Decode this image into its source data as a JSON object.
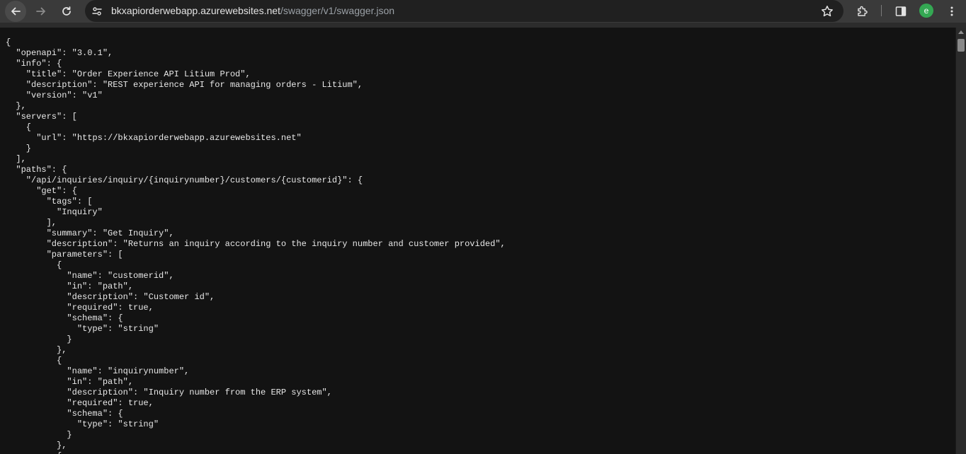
{
  "browser": {
    "url_host": "bkxapiorderwebapp.azurewebsites.net",
    "url_path": "/swagger/v1/swagger.json",
    "profile_initial": "e",
    "icons": {
      "back": "arrow-left-icon",
      "forward": "arrow-right-icon",
      "reload": "reload-icon",
      "site_info": "tune-icon",
      "bookmark": "star-icon",
      "extensions": "puzzle-icon",
      "side_panel": "side-panel-icon",
      "menu": "kebab-menu-icon"
    },
    "colors": {
      "toolbar": "#3a3a3a",
      "omnibox": "#202020",
      "page_background": "#131313",
      "avatar": "#34a853"
    }
  },
  "json_text": "{\n  \"openapi\": \"3.0.1\",\n  \"info\": {\n    \"title\": \"Order Experience API Litium Prod\",\n    \"description\": \"REST experience API for managing orders - Litium\",\n    \"version\": \"v1\"\n  },\n  \"servers\": [\n    {\n      \"url\": \"https://bkxapiorderwebapp.azurewebsites.net\"\n    }\n  ],\n  \"paths\": {\n    \"/api/inquiries/inquiry/{inquirynumber}/customers/{customerid}\": {\n      \"get\": {\n        \"tags\": [\n          \"Inquiry\"\n        ],\n        \"summary\": \"Get Inquiry\",\n        \"description\": \"Returns an inquiry according to the inquiry number and customer provided\",\n        \"parameters\": [\n          {\n            \"name\": \"customerid\",\n            \"in\": \"path\",\n            \"description\": \"Customer id\",\n            \"required\": true,\n            \"schema\": {\n              \"type\": \"string\"\n            }\n          },\n          {\n            \"name\": \"inquirynumber\",\n            \"in\": \"path\",\n            \"description\": \"Inquiry number from the ERP system\",\n            \"required\": true,\n            \"schema\": {\n              \"type\": \"string\"\n            }\n          },\n          {"
}
